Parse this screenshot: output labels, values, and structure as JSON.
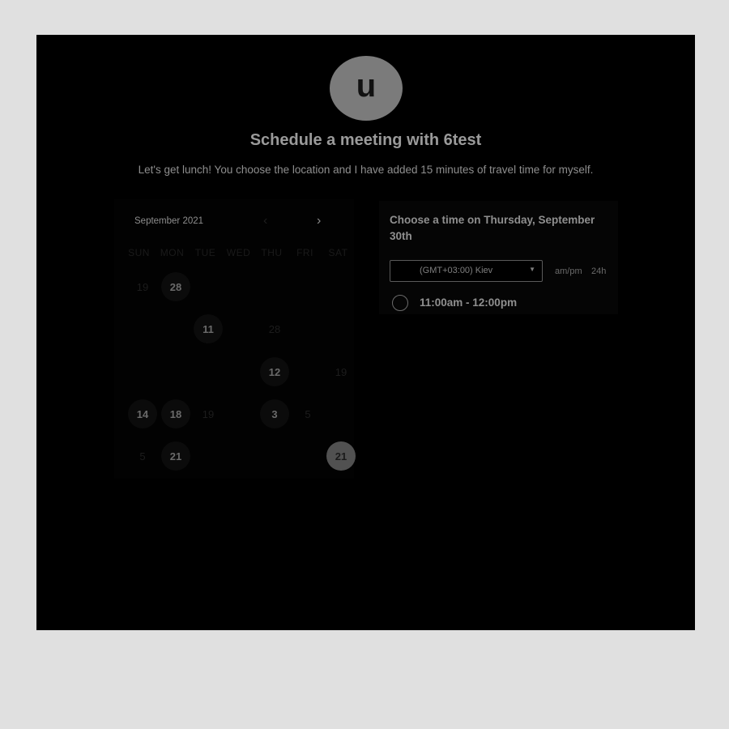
{
  "profile": {
    "avatar_letter": "u",
    "title": "Schedule a meeting with 6test",
    "description": "Let's get lunch! You choose the location and I have added 15 minutes of travel time for myself."
  },
  "calendar": {
    "month_label": "September 2021",
    "prev_icon": "‹",
    "next_icon": "›",
    "weekdays": [
      "SUN",
      "MON",
      "TUE",
      "WED",
      "THU",
      "FRI",
      "SAT"
    ],
    "days": [
      {
        "label": "19",
        "state": "dim"
      },
      {
        "label": "28",
        "state": "available"
      },
      {
        "label": "11",
        "state": "available"
      },
      {
        "label": "28",
        "state": "dim"
      },
      {
        "label": "12",
        "state": "available"
      },
      {
        "label": "19",
        "state": "dim"
      },
      {
        "label": "14",
        "state": "available"
      },
      {
        "label": "18",
        "state": "available"
      },
      {
        "label": "19",
        "state": "dim"
      },
      {
        "label": "3",
        "state": "available"
      },
      {
        "label": "5",
        "state": "dim"
      },
      {
        "label": "5",
        "state": "dim"
      },
      {
        "label": "21",
        "state": "available"
      },
      {
        "label": "21",
        "state": "selected"
      }
    ]
  },
  "time_panel": {
    "heading": "Choose a time on Thursday, September 30th",
    "timezone": "(GMT+03:00) Kiev",
    "format_ampm": "am/pm",
    "format_24h": "24h",
    "slots": [
      {
        "label": "11:00am - 12:00pm"
      }
    ]
  },
  "colors": {
    "background": "#000000",
    "outer": "#e0e0e0",
    "avatar": "#7b7b7b",
    "selected_day": "#515151"
  }
}
